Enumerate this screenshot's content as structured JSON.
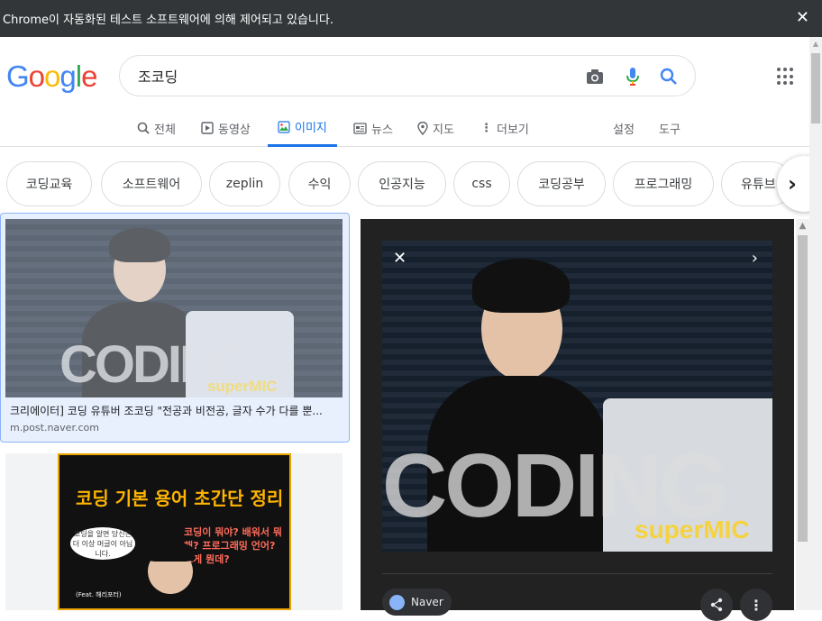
{
  "infobar": {
    "message": "Chrome이 자동화된 테스트 소프트웨어에 의해 제어되고 있습니다.",
    "close": "✕"
  },
  "logo": {
    "letters": [
      "G",
      "o",
      "o",
      "g",
      "l",
      "e"
    ],
    "colors": [
      "#4285F4",
      "#EA4335",
      "#FBBC05",
      "#4285F4",
      "#34A853",
      "#EA4335"
    ]
  },
  "search": {
    "query": "조코딩"
  },
  "tabs": [
    {
      "label": "전체",
      "icon": "search-icon"
    },
    {
      "label": "동영상",
      "icon": "video-icon"
    },
    {
      "label": "이미지",
      "icon": "image-icon",
      "active": true
    },
    {
      "label": "뉴스",
      "icon": "news-icon"
    },
    {
      "label": "지도",
      "icon": "map-pin-icon"
    },
    {
      "label": "더보기",
      "icon": "more-vert-icon"
    },
    {
      "label": "설정"
    },
    {
      "label": "도구"
    }
  ],
  "chips": [
    "코딩교육",
    "소프트웨어",
    "zeplin",
    "수익",
    "인공지능",
    "css",
    "코딩공부",
    "프로그래밍",
    "유튜브"
  ],
  "results": [
    {
      "caption": "크리에이터] 코딩 유튜버 조코딩 \"전공과 비전공, 글자 수가 다를 뿐...",
      "source": "m.post.naver.com",
      "overlay_text": "CODING",
      "brand": "superMIC"
    },
    {
      "poster_title": "코딩 기본 용어 초간단 정리",
      "bubble": "코딩을 알면 당신은 더 이상 머글이 아닙니다.",
      "question": "코딩이 뭐야? 배워서 뭐해? 프로그래밍 언어? 그게 뭔데?",
      "feat": "(Feat. 해리포터)"
    }
  ],
  "panel": {
    "overlay_text": "CODING",
    "brand": "superMIC",
    "source_label": "Naver",
    "close": "✕",
    "next": "›"
  }
}
